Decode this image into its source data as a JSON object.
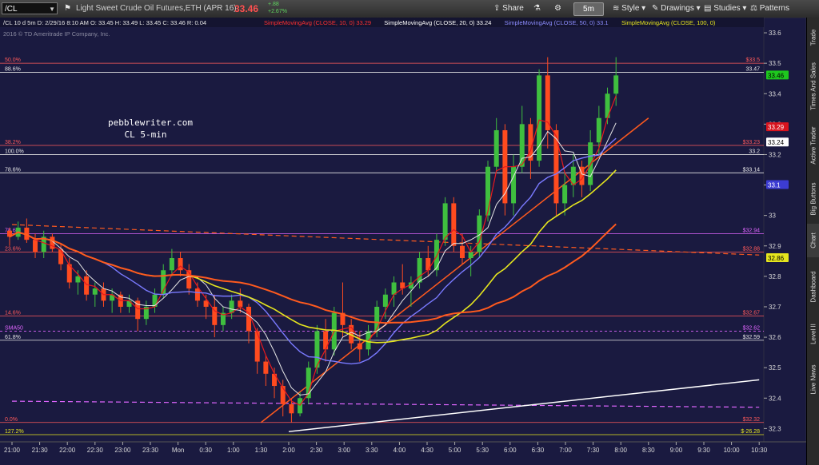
{
  "toolbar": {
    "symbol": "/CL",
    "description": "Light Sweet Crude Oil Futures,ETH (APR 16)",
    "price": "33.46",
    "change1": "+.88",
    "change2": "+2.67%",
    "share": "Share",
    "interval": "5m",
    "style": "Style",
    "drawings": "Drawings",
    "studies": "Studies",
    "patterns": "Patterns"
  },
  "sidebar": [
    "Trade",
    "Times And Sales",
    "Active Trader",
    "Big Buttons",
    "Chart",
    "Dashboard",
    "Level II",
    "Live News"
  ],
  "colors": {
    "background": "#1a1a40",
    "candle_up": "#3fbf3f",
    "candle_down": "#ff4b1f",
    "sma10": "#e8191e",
    "sma20": "#e6e6e6",
    "sma50": "#7a7aff",
    "sma100": "#e6e61e",
    "sma200": "#ff5a1e",
    "fib": "#ff5a5a"
  },
  "chart_data": {
    "type": "candlestick",
    "header_line": "/CL 10 d 5m   D: 2/29/16 8:10 AM   O: 33.45   H: 33.49   L: 33.45   C: 33.46   R: 0.04",
    "copyright": "2016 © TD Ameritrade IP Company, Inc.",
    "annotation": [
      "pebblewriter.com",
      "CL 5-min"
    ],
    "studies": [
      {
        "label": "SimpleMovingAvg (CLOSE, 10, 0)",
        "value": "33.29",
        "color": "#ff3030"
      },
      {
        "label": "SimpleMovingAvg (CLOSE, 20, 0)",
        "value": "33.24",
        "color": "#ffffff"
      },
      {
        "label": "SimpleMovingAvg (CLOSE, 50, 0)",
        "value": "33.1",
        "color": "#8c8cff"
      },
      {
        "label": "SimpleMovingAvg (CLOSE, 100, 0)",
        "value": "",
        "color": "#e6e61e"
      }
    ],
    "y_ticks": [
      32.3,
      32.4,
      32.5,
      32.6,
      32.7,
      32.8,
      32.9,
      33,
      33.1,
      33.2,
      33.3,
      33.4,
      33.5,
      33.6
    ],
    "ylim": [
      32.28,
      33.65
    ],
    "x_ticks": [
      "21:00",
      "21:30",
      "22:00",
      "22:30",
      "23:00",
      "23:30",
      "Mon",
      "0:30",
      "1:00",
      "1:30",
      "2:00",
      "2:30",
      "3:00",
      "3:30",
      "4:00",
      "4:30",
      "5:00",
      "5:30",
      "6:00",
      "6:30",
      "7:00",
      "7:30",
      "8:00",
      "8:30",
      "9:00",
      "9:30",
      "10:00",
      "10:30"
    ],
    "price_badges": [
      {
        "value": "33.46",
        "bg": "#1ec81e",
        "fg": "#000000"
      },
      {
        "value": "33.29",
        "bg": "#d8141e",
        "fg": "#ffffff"
      },
      {
        "value": "33.24",
        "bg": "#ffffff",
        "fg": "#000000"
      },
      {
        "value": "33.1",
        "bg": "#3c3cd2",
        "fg": "#ffffff"
      },
      {
        "value": "32.86",
        "bg": "#e6e61e",
        "fg": "#000000"
      }
    ],
    "levels": [
      {
        "price": 33.5,
        "left": "50.0%",
        "right": "$33.5",
        "color": "#ff5a5a",
        "dash": false
      },
      {
        "price": 33.47,
        "left": "88.6%",
        "right": "33.47",
        "color": "#e6e6e6",
        "dash": false
      },
      {
        "price": 33.23,
        "left": "38.2%",
        "right": "$33.23",
        "color": "#ff5a5a",
        "dash": false
      },
      {
        "price": 33.2,
        "left": "100.0%",
        "right": "33.2",
        "color": "#e6e6e6",
        "dash": false
      },
      {
        "price": 33.14,
        "left": "78.6%",
        "right": "$33.14",
        "color": "#e6e6e6",
        "dash": false
      },
      {
        "price": 32.94,
        "left": "78.6%",
        "right": "$32.94",
        "color": "#e066ff",
        "dash": false
      },
      {
        "price": 32.88,
        "left": "23.6%",
        "right": "$32.88",
        "color": "#ff5a5a",
        "dash": false
      },
      {
        "price": 32.67,
        "left": "14.6%",
        "right": "$32.67",
        "color": "#ff5a5a",
        "dash": false
      },
      {
        "price": 32.62,
        "left": "SMA50",
        "right": "$32.62",
        "color": "#e066ff",
        "dash": true
      },
      {
        "price": 32.59,
        "left": "61.8%",
        "right": "$32.59",
        "color": "#e6e6e6",
        "dash": false
      },
      {
        "price": 32.32,
        "left": "0.0%",
        "right": "$32.32",
        "color": "#ff5a5a",
        "dash": false
      },
      {
        "price": 32.28,
        "left": "127.2%",
        "right": "$-26.28",
        "color": "#e6e61e",
        "dash": false
      }
    ],
    "trendlines": [
      {
        "from": [
          "21:00",
          32.97
        ],
        "to": [
          "10:30",
          32.87
        ],
        "color": "#ff5a1e",
        "dash": true
      },
      {
        "from": [
          "21:00",
          32.39
        ],
        "to": [
          "10:30",
          32.37
        ],
        "color": "#e066ff",
        "dash": true
      },
      {
        "from": [
          "1:30",
          32.32
        ],
        "to": [
          "8:30",
          33.32
        ],
        "color": "#ff5a1e",
        "dash": false
      },
      {
        "from": [
          "2:00",
          32.29
        ],
        "to": [
          "10:30",
          32.46
        ],
        "color": "#ffffff",
        "dash": false
      }
    ],
    "candles": [
      [
        32.95,
        32.96,
        32.9,
        32.93
      ],
      [
        32.93,
        32.98,
        32.92,
        32.96
      ],
      [
        32.96,
        32.99,
        32.91,
        32.92
      ],
      [
        32.92,
        32.94,
        32.86,
        32.88
      ],
      [
        32.88,
        32.95,
        32.86,
        32.93
      ],
      [
        32.93,
        32.94,
        32.88,
        32.89
      ],
      [
        32.89,
        32.91,
        32.82,
        32.84
      ],
      [
        32.84,
        32.86,
        32.76,
        32.78
      ],
      [
        32.78,
        32.82,
        32.74,
        32.8
      ],
      [
        32.8,
        32.82,
        32.72,
        32.74
      ],
      [
        32.74,
        32.78,
        32.7,
        32.76
      ],
      [
        32.76,
        32.78,
        32.7,
        32.72
      ],
      [
        32.72,
        32.76,
        32.68,
        32.74
      ],
      [
        32.74,
        32.75,
        32.68,
        32.7
      ],
      [
        32.7,
        32.74,
        32.68,
        32.72
      ],
      [
        32.72,
        32.73,
        32.62,
        32.66
      ],
      [
        32.66,
        32.72,
        32.64,
        32.7
      ],
      [
        32.7,
        32.76,
        32.68,
        32.74
      ],
      [
        32.74,
        32.84,
        32.73,
        32.82
      ],
      [
        32.82,
        32.89,
        32.8,
        32.86
      ],
      [
        32.86,
        32.88,
        32.8,
        32.82
      ],
      [
        32.82,
        32.84,
        32.74,
        32.76
      ],
      [
        32.76,
        32.78,
        32.7,
        32.72
      ],
      [
        32.72,
        32.74,
        32.66,
        32.7
      ],
      [
        32.7,
        32.74,
        32.6,
        32.64
      ],
      [
        32.64,
        32.7,
        32.62,
        32.68
      ],
      [
        32.68,
        32.74,
        32.66,
        32.72
      ],
      [
        32.72,
        32.76,
        32.68,
        32.7
      ],
      [
        32.7,
        32.71,
        32.58,
        32.62
      ],
      [
        32.62,
        32.63,
        32.48,
        32.52
      ],
      [
        32.52,
        32.54,
        32.44,
        32.48
      ],
      [
        32.48,
        32.5,
        32.4,
        32.44
      ],
      [
        32.44,
        32.46,
        32.34,
        32.38
      ],
      [
        32.38,
        32.4,
        32.32,
        32.35
      ],
      [
        32.35,
        32.42,
        32.34,
        32.4
      ],
      [
        32.4,
        32.52,
        32.38,
        32.5
      ],
      [
        32.5,
        32.64,
        32.48,
        32.62
      ],
      [
        32.62,
        32.66,
        32.52,
        32.56
      ],
      [
        32.56,
        32.7,
        32.54,
        32.68
      ],
      [
        32.68,
        32.78,
        32.6,
        32.64
      ],
      [
        32.64,
        32.66,
        32.56,
        32.58
      ],
      [
        32.58,
        32.62,
        32.52,
        32.56
      ],
      [
        32.56,
        32.64,
        32.54,
        32.62
      ],
      [
        32.62,
        32.72,
        32.6,
        32.7
      ],
      [
        32.7,
        32.76,
        32.66,
        32.74
      ],
      [
        32.74,
        32.8,
        32.7,
        32.78
      ],
      [
        32.78,
        32.84,
        32.74,
        32.76
      ],
      [
        32.76,
        32.8,
        32.7,
        32.78
      ],
      [
        32.78,
        32.88,
        32.76,
        32.86
      ],
      [
        32.86,
        32.9,
        32.8,
        32.82
      ],
      [
        32.82,
        32.94,
        32.8,
        32.92
      ],
      [
        32.92,
        33.06,
        32.9,
        33.04
      ],
      [
        33.04,
        33.06,
        32.88,
        32.9
      ],
      [
        32.9,
        32.94,
        32.84,
        32.86
      ],
      [
        32.86,
        32.9,
        32.8,
        32.88
      ],
      [
        32.88,
        33.02,
        32.86,
        33.0
      ],
      [
        33.0,
        33.18,
        32.98,
        33.16
      ],
      [
        33.16,
        33.32,
        33.14,
        33.28
      ],
      [
        33.28,
        33.3,
        33.0,
        33.04
      ],
      [
        33.04,
        33.2,
        33.0,
        33.16
      ],
      [
        33.16,
        33.36,
        33.14,
        33.3
      ],
      [
        33.3,
        33.32,
        33.12,
        33.18
      ],
      [
        33.18,
        33.48,
        33.16,
        33.46
      ],
      [
        33.46,
        33.52,
        33.22,
        33.28
      ],
      [
        33.28,
        33.3,
        33.0,
        33.04
      ],
      [
        33.04,
        33.14,
        33.0,
        33.1
      ],
      [
        33.1,
        33.2,
        33.06,
        33.16
      ],
      [
        33.16,
        33.18,
        33.06,
        33.1
      ],
      [
        33.1,
        33.28,
        33.08,
        33.24
      ],
      [
        33.24,
        33.36,
        33.2,
        33.32
      ],
      [
        33.32,
        33.42,
        33.3,
        33.4
      ],
      [
        33.4,
        33.52,
        33.36,
        33.46
      ]
    ]
  }
}
